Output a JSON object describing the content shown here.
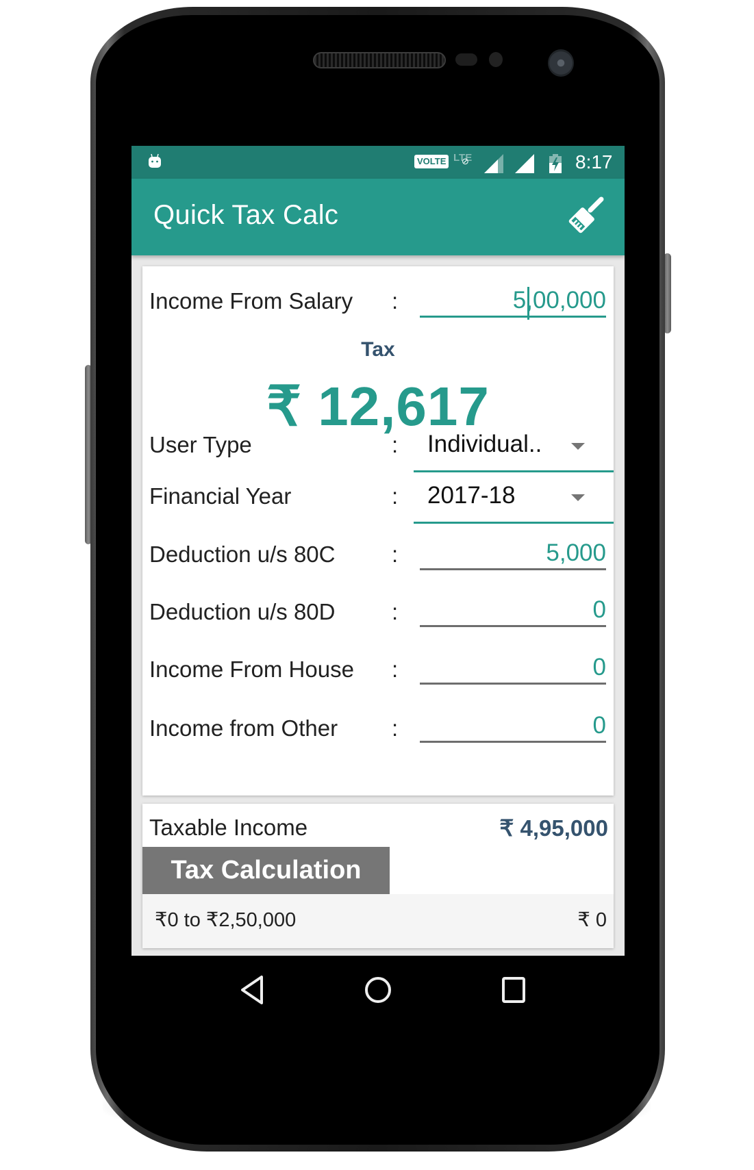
{
  "status_bar": {
    "notification_icon": "android-robot-icon",
    "volte_label": "VOLTE",
    "lte_label": "LTE",
    "icons": [
      "signal-icon",
      "signal-icon",
      "battery-charging-icon"
    ],
    "time": "8:17"
  },
  "app_bar": {
    "title": "Quick Tax Calc",
    "action_icon": "broom-clear-icon"
  },
  "form": {
    "income_salary": {
      "label": "Income From Salary",
      "separator": ":",
      "value": "5,00,000"
    },
    "tax": {
      "label": "Tax",
      "value": "₹ 12,617"
    },
    "user_type": {
      "label": "User Type",
      "separator": ":",
      "selected": "Individual.."
    },
    "financial_year": {
      "label": "Financial Year",
      "separator": ":",
      "selected": "2017-18"
    },
    "deduction_80c": {
      "label": "Deduction u/s 80C",
      "separator": ":",
      "value": "5,000"
    },
    "deduction_80d": {
      "label": "Deduction u/s 80D",
      "separator": ":",
      "value": "0"
    },
    "income_house": {
      "label": "Income From House",
      "separator": ":",
      "value": "0"
    },
    "income_other": {
      "label": "Income from Other",
      "separator": ":",
      "value": "0"
    }
  },
  "summary": {
    "taxable_income_label": "Taxable Income",
    "taxable_income_value": "₹ 4,95,000",
    "tax_calculation_label": "Tax Calculation",
    "slabs": [
      {
        "range": "₹0 to ₹2,50,000",
        "tax": "₹ 0"
      }
    ]
  },
  "nav_bar": {
    "back": "back-icon",
    "home": "home-icon",
    "recents": "recents-icon"
  },
  "colors": {
    "primary": "#269a8c",
    "primary_dark": "#207d72",
    "heading": "#35536e",
    "button_gray": "#767676"
  }
}
